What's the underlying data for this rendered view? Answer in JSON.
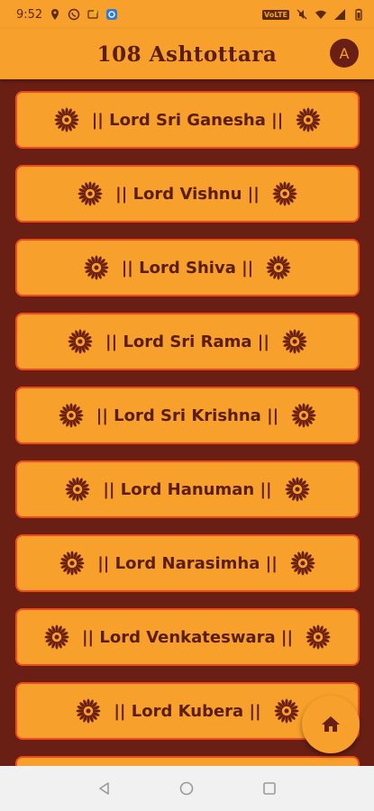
{
  "status_bar": {
    "time": "9:52",
    "speed_badge": "VoLTE"
  },
  "app_bar": {
    "title": "108 Ashtottara",
    "avatar_letter": "A"
  },
  "deities": [
    {
      "label": "|| Lord Sri Ganesha ||"
    },
    {
      "label": "|| Lord Vishnu ||"
    },
    {
      "label": "|| Lord Shiva ||"
    },
    {
      "label": "|| Lord Sri Rama ||"
    },
    {
      "label": "|| Lord Sri Krishna ||"
    },
    {
      "label": "|| Lord Hanuman ||"
    },
    {
      "label": "|| Lord Narasimha ||"
    },
    {
      "label": "|| Lord Venkateswara ||"
    },
    {
      "label": "|| Lord Kubera ||"
    }
  ],
  "icons": {
    "card_ornament": "mandala-icon",
    "fab": "home-icon",
    "nav": [
      "back-icon",
      "home-circle-icon",
      "recents-icon"
    ]
  },
  "colors": {
    "accent": "#f7a02b",
    "background": "#6a1f14",
    "text": "#5a1d10",
    "card_border": "#f04a1a"
  }
}
